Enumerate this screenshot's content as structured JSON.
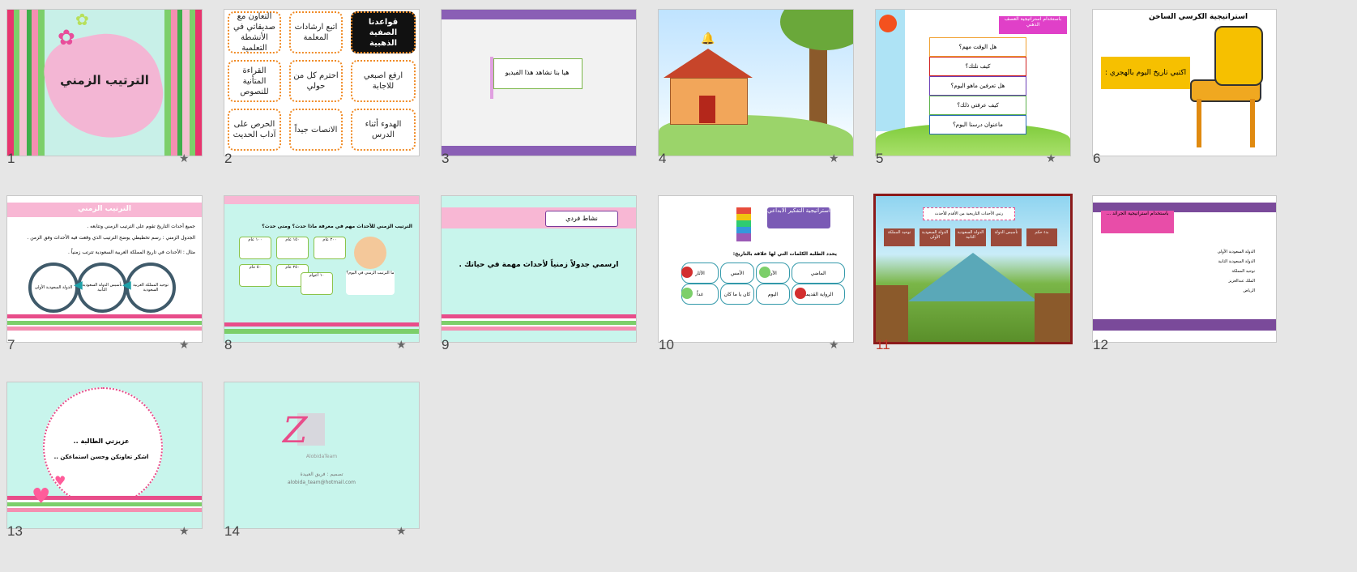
{
  "slides": [
    {
      "n": "1",
      "title": "الترتيب الزمني"
    },
    {
      "n": "2",
      "cards": [
        "اتبع ارشادات المعلمة",
        "التعاون مع صديقاتي في الأنشطة التعلمية",
        "قواعدنا الصفية الذهبية",
        "احترم كل من حولي",
        "القراءة المتأنية للنصوص",
        "ارفع اصبعي للاجابة",
        "الانصات جيداً",
        "الحرص على آداب الحديث",
        "الهدوء أثناء الدرس"
      ]
    },
    {
      "n": "3",
      "text": "هيا بنا نشاهد هذا الفيديو"
    },
    {
      "n": "4"
    },
    {
      "n": "5",
      "header": "باستخدام استراتيجية العصف الذهني",
      "questions": [
        "هل الوقت مهم؟",
        "كيف نلتك؟",
        "هل تعرفين ماهو اليوم؟",
        "كيف عرفتي ذلك؟",
        "ماعنوان درسنا اليوم؟"
      ]
    },
    {
      "n": "6",
      "title": "استراتيجية الكرسي الساخن",
      "text": "اكتبي تاريخ اليوم بالهجري :"
    },
    {
      "n": "7",
      "title": "الترتيب الزمني",
      "line1": "جميع أحداث التاريخ تقوم على الترتيب الزمني وتتابعه .",
      "line2": "الجدول الزمني : رسم تخطيطي يوضح الترتيب الذي وقعت فيه الأحداث وفق الزمن .",
      "line3": "مثال : الأحداث في تاريخ المملكة العربية السعودية تترتب زمنياً .",
      "bubbles": [
        "توحيد المملكة العربية السعودية",
        "تأسيس الدولة السعودية الثانية",
        "الدولة السعودية الأولى"
      ]
    },
    {
      "n": "8",
      "title": "الترتيب الزمني للأحداث مهم في معرفة ماذا حدث؟ ومتى حدث؟",
      "boxes": [
        "١٠٠ عام",
        "١٥٠ عام",
        "٢٠٠ عام",
        "٥٠ عام",
        "٢٥٠ عام",
        "١٠ أعوام"
      ],
      "caption": "ما الترتيب الزمني في اليوم؟"
    },
    {
      "n": "9",
      "header": "نشاط فردي",
      "text": "ارسمي جدولاً زمنياً لأحداث مهمة في حياتك ."
    },
    {
      "n": "10",
      "title": "استراتيجية التفكير الابداعي",
      "question": "يحدد الطلبة الكلمات التي لها علاقة بالتاريخ:",
      "words": [
        "الماضي",
        "الآن",
        "الأمس",
        "الآثار",
        "الرواية القديمة",
        "اليوم",
        "كان يا ما كان",
        "غداً"
      ]
    },
    {
      "n": "11",
      "title": "رتبي الأحداث التاريخية من الأقدم للأحدث",
      "labels": [
        "توحيد المملكة",
        "الدولة السعودية الأولى",
        "الدولة السعودية الثانية",
        "تأسيس الدولة",
        "بدء حكم"
      ]
    },
    {
      "n": "12",
      "header": "باستخدام استراتيجية الجرائد ...",
      "items": [
        "الدولة السعودية الأولى",
        "الدولة السعودية الثانية",
        "توحيد المملكة",
        "الملك عبدالعزيز",
        "الرياض"
      ]
    },
    {
      "n": "13",
      "line1": "عزيزتي الطالبة ..",
      "line2": "اشكر تعاونكن وحسن استماعكن .."
    },
    {
      "n": "14",
      "brand": "AlobidaTeam",
      "line1": "تصميم : فريق العبيدة",
      "line2": "alobida_team@hotmail.com"
    }
  ],
  "star_glyph": "★"
}
